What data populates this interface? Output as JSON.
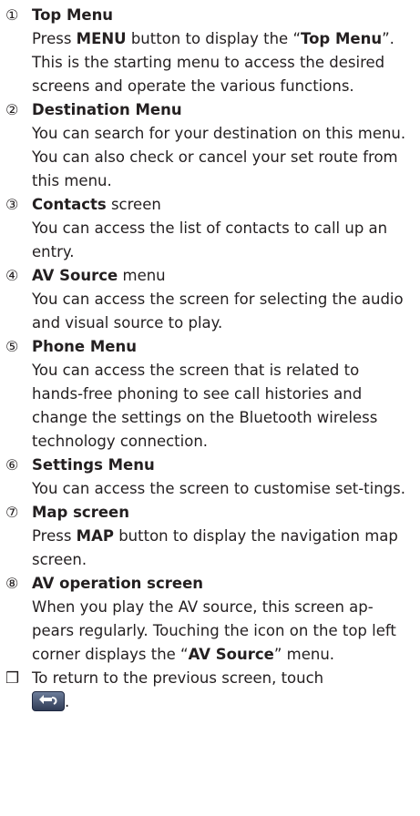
{
  "entries": [
    {
      "number": "①",
      "title": "Top Menu",
      "title_suffix": "",
      "lines": [
        [
          {
            "t": "Press "
          },
          {
            "t": "MENU",
            "b": true
          },
          {
            "t": " button to display the “"
          },
          {
            "t": "Top Menu",
            "b": true
          },
          {
            "t": "”."
          }
        ],
        [
          {
            "t": "This is the starting menu to access the desired screens and operate the various functions."
          }
        ]
      ]
    },
    {
      "number": "②",
      "title": "Destination Menu",
      "title_suffix": "",
      "lines": [
        [
          {
            "t": "You can search for your destination on this menu. You can also check or cancel your set route from this menu."
          }
        ]
      ]
    },
    {
      "number": "③",
      "title": "Contacts",
      "title_suffix": " screen",
      "lines": [
        [
          {
            "t": "You can access the list of contacts to call up an entry."
          }
        ]
      ]
    },
    {
      "number": "④",
      "title": "AV Source",
      "title_suffix": " menu",
      "lines": [
        [
          {
            "t": "You can access the screen for selecting the audio and visual source to play."
          }
        ]
      ]
    },
    {
      "number": "⑤",
      "title": "Phone Menu",
      "title_suffix": "",
      "lines": [
        [
          {
            "t": "You can access the screen that is related to hands-free phoning to see call histories and change the settings on the Bluetooth wireless technology connection."
          }
        ]
      ]
    },
    {
      "number": "⑥",
      "title": "Settings Menu",
      "title_suffix": "",
      "lines": [
        [
          {
            "t": "You can access the screen to customise set-tings."
          }
        ]
      ]
    },
    {
      "number": "⑦",
      "title": "Map screen",
      "title_suffix": "",
      "lines": [
        [
          {
            "t": "Press "
          },
          {
            "t": "MAP",
            "b": true
          },
          {
            "t": " button to display the navigation map screen."
          }
        ]
      ]
    },
    {
      "number": "⑧",
      "title": "AV operation screen",
      "title_suffix": "",
      "lines": [
        [
          {
            "t": "When you play the AV source, this screen ap-pears regularly. Touching the icon on the top left corner displays the “"
          },
          {
            "t": "AV Source",
            "b": true
          },
          {
            "t": "” menu."
          }
        ]
      ]
    }
  ],
  "note": {
    "bullet": "❒",
    "text": "To return to the previous screen, touch",
    "icon": "back-arrow-icon",
    "after_icon": "."
  },
  "colors": {
    "text": "#231f20",
    "button_top": "#6d7d9a",
    "button_bottom": "#2f3b55"
  }
}
